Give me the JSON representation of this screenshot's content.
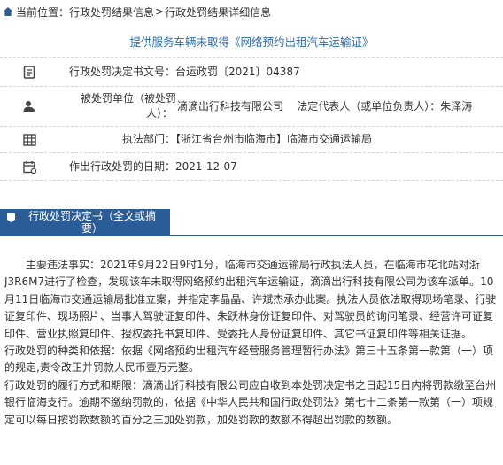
{
  "breadcrumb": {
    "prefix": "当前位置：",
    "link1": "行政处罚结果信息",
    "sep": ">",
    "current": "行政处罚结果详细信息"
  },
  "case_title": "提供服务车辆未取得《网络预约出租汽车运输证》",
  "info": {
    "doc_number": "行政处罚决定书文号：台运政罚〔2021〕04387",
    "party_line1": "被处罚单位（被处罚",
    "party_line1b": "滴滴出行科技有限公司    法定代表人（或单位负责人）：朱泽涛",
    "party_line2": "人）：",
    "agency": "执法部门：【浙江省台州市临海市】临海市交通运输局",
    "date": "作出行政处罚的日期：2021-12-07"
  },
  "section": {
    "title_line1": "行政处罚决定书（全文或摘",
    "title_line2": "要）"
  },
  "decision": {
    "para1": "主要违法事实：2021年9月22日9时1分，临海市交通运输局行政执法人员，在临海市花北站对浙J3R6M7进行了检查，发现该车未取得网络预约出租汽车运输证，滴滴出行科技有限公司为该车派单。10月11日临海市交通运输局批准立案，并指定李晶晶、许斌杰承办此案。执法人员依法取得现场笔录、行驶证复印件、现场照片、当事人驾驶证复印件、朱跃林身份证复印件、对驾驶员的询问笔录、经营许可证复印件、营业执照复印件、授权委托书复印件、受委托人身份证复印件、其它书证复印件等相关证据。",
    "para2": "行政处罚的种类和依据：依据《网络预约出租汽车经营服务管理暂行办法》第三十五条第一款第（一）项的规定,责令改正并罚款人民币壹万元整。",
    "para3": "行政处罚的履行方式和期限：滴滴出行科技有限公司应自收到本处罚决定书之日起15日内将罚款缴至台州银行临海支行。逾期不缴纳罚款的，依据《中华人民共和国行政处罚法》第七十二条第一款第（一）项规定可以每日按罚款数额的百分之三加处罚款，加处罚款的数额不得超出罚款的数额。"
  },
  "colors": {
    "accent": "#2a5c97",
    "link": "#2a6bb5"
  },
  "icons": [
    "home-icon",
    "document-icon",
    "person-icon",
    "building-icon",
    "calendar-icon",
    "pin-icon"
  ]
}
